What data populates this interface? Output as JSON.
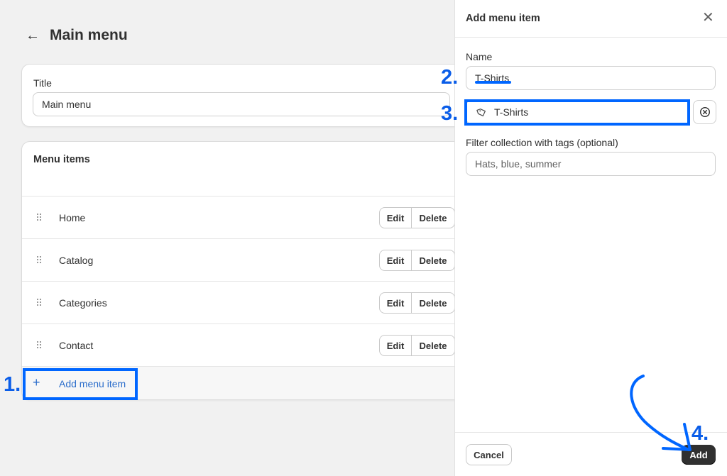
{
  "page": {
    "title": "Main menu"
  },
  "title_card": {
    "label": "Title",
    "value": "Main menu"
  },
  "menu_items_card": {
    "heading": "Menu items",
    "items": [
      {
        "label": "Home"
      },
      {
        "label": "Catalog"
      },
      {
        "label": "Categories"
      },
      {
        "label": "Contact"
      }
    ],
    "edit_label": "Edit",
    "delete_label": "Delete",
    "add_label": "Add menu item"
  },
  "panel": {
    "title": "Add menu item",
    "name_label": "Name",
    "name_value": "T-Shirts",
    "link_value": "T-Shirts",
    "filter_label": "Filter collection with tags (optional)",
    "filter_placeholder": "Hats, blue, summer",
    "cancel_label": "Cancel",
    "add_label": "Add"
  },
  "annotations": {
    "step1": "1.",
    "step2": "2.",
    "step3": "3.",
    "step4": "4.",
    "color": "#0066ff"
  },
  "icons": {
    "back": "arrow-left-icon",
    "drag": "drag-handle-icon",
    "plus": "plus-icon",
    "close": "close-icon",
    "tag": "tag-icon",
    "remove": "circle-x-icon"
  }
}
